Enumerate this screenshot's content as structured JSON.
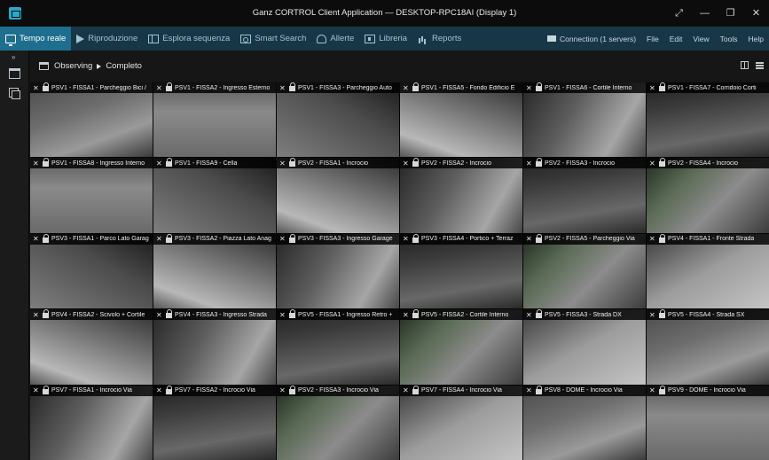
{
  "window": {
    "title": "Ganz CORTROL Client Application — DESKTOP-RPC18AI (Display 1)",
    "controls": [
      {
        "name": "expand-icon",
        "glyph": "⤢"
      },
      {
        "name": "minimize-icon",
        "glyph": "—"
      },
      {
        "name": "restore-icon",
        "glyph": "❐"
      },
      {
        "name": "close-icon",
        "glyph": "✕"
      }
    ]
  },
  "menu": {
    "items": [
      {
        "label": "Tempo reale",
        "icon": "monitor-icon",
        "active": true
      },
      {
        "label": "Riproduzione",
        "icon": "play-icon"
      },
      {
        "label": "Esplora sequenza",
        "icon": "sequence-icon"
      },
      {
        "label": "Smart Search",
        "icon": "smart-search-icon"
      },
      {
        "label": "Allerte",
        "icon": "bell-icon"
      },
      {
        "label": "Libreria",
        "icon": "library-icon"
      },
      {
        "label": "Reports",
        "icon": "reports-icon"
      }
    ],
    "connection": "Connection (1 servers)",
    "right_items": [
      "File",
      "Edit",
      "View",
      "Tools",
      "Help"
    ]
  },
  "sidebar": {
    "expand_glyph": "»"
  },
  "breadcrumb": {
    "root": "Observing",
    "current": "Completo"
  },
  "accent_color": "#1d6e8f",
  "tiles": [
    {
      "label": "PSV1 - FISSA1 - Parcheggio Bici /"
    },
    {
      "label": "PSV1 - FISSA2 - Ingresso Esterno"
    },
    {
      "label": "PSV1 - FISSA3 - Parcheggio Auto"
    },
    {
      "label": "PSV1 - FISSA5 - Fondo Edificio E"
    },
    {
      "label": "PSV1 - FISSA6 - Cortile Interno"
    },
    {
      "label": "PSV1 - FISSA7 - Corridoio Corti"
    },
    {
      "label": "PSV1 - FISSA8 - Ingresso Interno"
    },
    {
      "label": "PSV1 - FISSA9 - Cella"
    },
    {
      "label": "PSV2 - FISSA1 - Incrocio"
    },
    {
      "label": "PSV2 - FISSA2 - Incrocio"
    },
    {
      "label": "PSV2 - FISSA3 - Incrocio"
    },
    {
      "label": "PSV2 - FISSA4 - Incrocio"
    },
    {
      "label": "PSV3 - FISSA1 - Parco Lato Garag"
    },
    {
      "label": "PSV3 - FISSA2 - Piazza Lato Anag"
    },
    {
      "label": "PSV3 - FISSA3 - Ingresso Garage"
    },
    {
      "label": "PSV3 - FISSA4 - Portico + Terraz"
    },
    {
      "label": "PSV2 - FISSA5 - Parcheggio Via"
    },
    {
      "label": "PSV4 - FISSA1 - Fronte Strada"
    },
    {
      "label": "PSV4 - FISSA2 - Scivolo + Cortile"
    },
    {
      "label": "PSV4 - FISSA3 - Ingresso Strada"
    },
    {
      "label": "PSV5 - FISSA1 - Ingresso Retro +"
    },
    {
      "label": "PSV5 - FISSA2 - Cortile Interno"
    },
    {
      "label": "PSV5 - FISSA3 - Strada DX"
    },
    {
      "label": "PSV5 - FISSA4 - Strada SX"
    },
    {
      "label": "PSV7 - FISSA1 - Incrocio Via"
    },
    {
      "label": "PSV7 - FISSA2 - Incrocio Via"
    },
    {
      "label": "PSV2 - FISSA3 - Incrocio Via"
    },
    {
      "label": "PSV7 - FISSA4 - Incrocio Via"
    },
    {
      "label": "PSV8 - DOME - Incrocio Via"
    },
    {
      "label": "PSV9 - DOME - Incrocio Via"
    }
  ]
}
